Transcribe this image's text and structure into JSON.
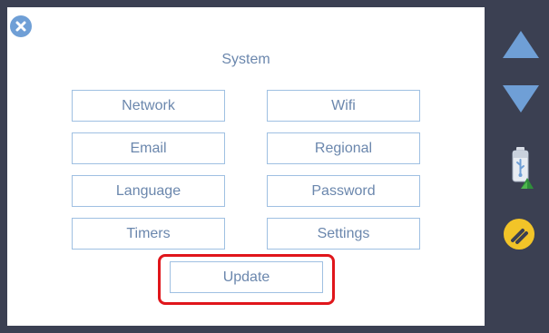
{
  "screen": {
    "title": "System"
  },
  "menu": {
    "network": "Network",
    "wifi": "Wifi",
    "email": "Email",
    "regional": "Regional",
    "language": "Language",
    "password": "Password",
    "timers": "Timers",
    "settings": "Settings",
    "update": "Update"
  },
  "icons": {
    "close": "close-icon",
    "scroll_up": "triangle-up-icon",
    "scroll_down": "triangle-down-icon",
    "usb": "usb-drive-icon",
    "tools": "wrench-screwdriver-icon"
  },
  "colors": {
    "frame": "#3b4052",
    "panel": "#ffffff",
    "accent_blue": "#6f9fd6",
    "text_blue": "#6b87ad",
    "button_border": "#9fc0e2",
    "highlight_red": "#e0161b",
    "tools_yellow": "#f2c428"
  }
}
